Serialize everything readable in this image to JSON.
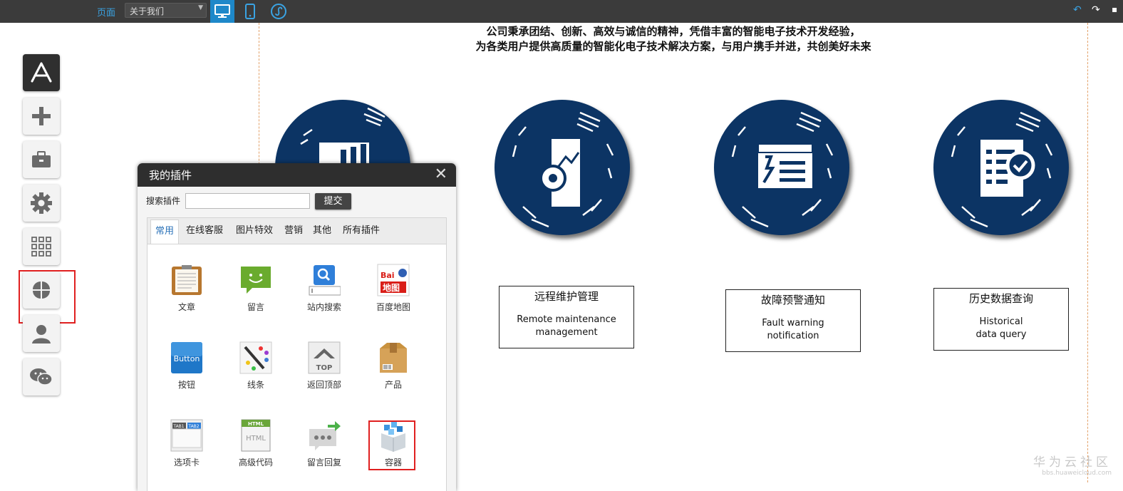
{
  "toolbar": {
    "page_label": "页面",
    "page_select_value": "关于我们",
    "view_buttons": [
      "desktop-icon",
      "mobile-icon",
      "miniprogram-icon"
    ],
    "right_icons": [
      "undo-icon",
      "redo-icon"
    ]
  },
  "left_toolbar": {
    "items": [
      "app-store-icon",
      "add-icon",
      "toolbox-icon",
      "settings-icon",
      "grid-icon",
      "plugin-icon",
      "user-icon",
      "wechat-icon"
    ]
  },
  "headline": {
    "line1": "公司秉承团结、创新、高效与诚信的精神，凭借丰富的智能电子技术开发经验，",
    "line2": "为各类用户提供高质量的智能化电子技术解决方案，与用户携手并进，共创美好未来"
  },
  "features": [
    {
      "cn": "远程维护管理",
      "en": "Remote maintenance\nmanagement",
      "icon": "gear-chart-icon"
    },
    {
      "cn": "故障预警通知",
      "en": "Fault warning\nnotification",
      "icon": "alert-document-icon"
    },
    {
      "cn": "历史数据查询",
      "en": "Historical\ndata query",
      "icon": "document-search-icon"
    }
  ],
  "plugin_dialog": {
    "title": "我的插件",
    "search_label": "搜索插件",
    "search_value": "",
    "submit_label": "提交",
    "tabs": [
      "常用",
      "在线客服",
      "图片特效",
      "营销",
      "其他",
      "所有插件"
    ],
    "active_tab": "常用",
    "plugins": [
      {
        "label": "文章",
        "icon": "article-icon"
      },
      {
        "label": "留言",
        "icon": "message-icon"
      },
      {
        "label": "站内搜索",
        "icon": "site-search-icon"
      },
      {
        "label": "百度地图",
        "icon": "baidu-map-icon",
        "icon_text": [
          "Bai",
          "地图"
        ]
      },
      {
        "label": "按钮",
        "icon": "button-icon",
        "icon_text": [
          "Button"
        ]
      },
      {
        "label": "线条",
        "icon": "line-icon"
      },
      {
        "label": "返回顶部",
        "icon": "back-to-top-icon",
        "icon_text": [
          "TOP"
        ]
      },
      {
        "label": "产品",
        "icon": "product-icon"
      },
      {
        "label": "选项卡",
        "icon": "tabs-icon",
        "icon_text": [
          "TAB1",
          "TAB2"
        ]
      },
      {
        "label": "高级代码",
        "icon": "html-code-icon",
        "icon_text": [
          "HTML",
          "HTML"
        ]
      },
      {
        "label": "留言回复",
        "icon": "message-reply-icon"
      },
      {
        "label": "容器",
        "icon": "container-icon"
      }
    ]
  },
  "watermark": {
    "line1": "华为云社区",
    "line2": "bbs.huaweicloud.com"
  },
  "colors": {
    "circle": "#0c3464",
    "accent": "#1e88c9",
    "highlight": "#e02020"
  }
}
